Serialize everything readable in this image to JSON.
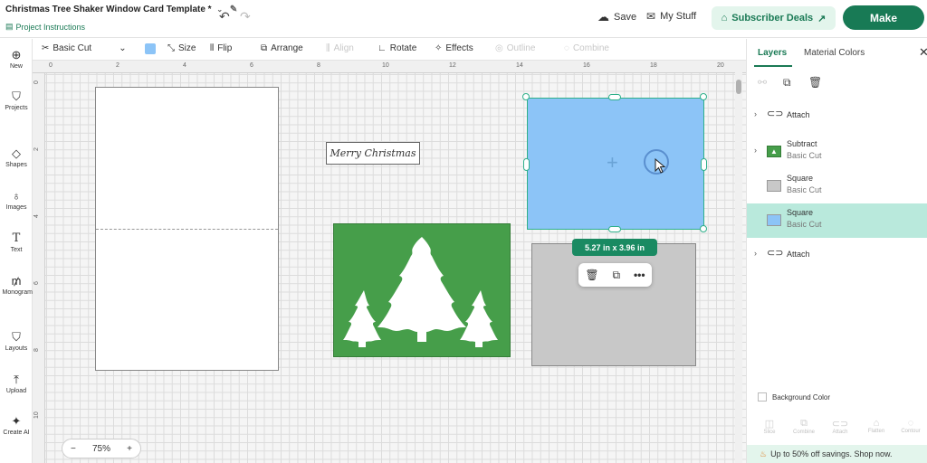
{
  "header": {
    "title": "Christmas Tree Shaker Window Card Template *",
    "project_instructions": "Project Instructions",
    "save": "Save",
    "my_stuff": "My Stuff",
    "subscriber_deals": "Subscriber Deals",
    "make": "Make"
  },
  "toolbar": {
    "operation": "Basic Cut",
    "size": "Size",
    "flip": "Flip",
    "arrange": "Arrange",
    "align": "Align",
    "rotate": "Rotate",
    "effects": "Effects",
    "outline": "Outline",
    "combine": "Combine",
    "swatch_color": "#8cc4f7"
  },
  "sidebar": {
    "items": [
      {
        "label": "New",
        "icon": "plus-circle-icon"
      },
      {
        "label": "Projects",
        "icon": "shirt-icon"
      },
      {
        "label": "Shapes",
        "icon": "shapes-icon"
      },
      {
        "label": "Images",
        "icon": "lightbulb-icon"
      },
      {
        "label": "Text",
        "icon": "text-icon"
      },
      {
        "label": "Monogram",
        "icon": "monogram-icon"
      },
      {
        "label": "Layouts",
        "icon": "layouts-icon"
      },
      {
        "label": "Upload",
        "icon": "upload-icon"
      },
      {
        "label": "Create AI",
        "icon": "sparkle-icon"
      }
    ]
  },
  "rulers": {
    "top": [
      "0",
      "2",
      "4",
      "6",
      "8",
      "10",
      "12",
      "14",
      "16",
      "18",
      "20"
    ],
    "left": [
      "0",
      "2",
      "4",
      "6",
      "8",
      "10"
    ]
  },
  "canvas": {
    "merry_text": "Merry Christmas",
    "dimensions": "5.27 in x 3.96 in",
    "zoom": "75%",
    "zoom_minus": "−",
    "zoom_plus": "+",
    "colors": {
      "green_panel": "#469e4a",
      "blue_square": "#8cc4f7",
      "grey_square": "#c8c8c8",
      "selection": "#2eb08a"
    }
  },
  "panel": {
    "tabs": [
      "Layers",
      "Material Colors"
    ],
    "layers": [
      {
        "name": "Attach",
        "sub": "",
        "expandable": true,
        "icon": "attach-icon"
      },
      {
        "name": "Subtract",
        "sub": "Basic Cut",
        "expandable": true,
        "icon": "tree-thumbnail"
      },
      {
        "name": "Square",
        "sub": "Basic Cut",
        "expandable": false,
        "icon": "grey-square-thumbnail"
      },
      {
        "name": "Square",
        "sub": "Basic Cut",
        "expandable": false,
        "icon": "blue-square-thumbnail",
        "selected": true
      },
      {
        "name": "Attach",
        "sub": "",
        "expandable": true,
        "icon": "attach-icon"
      }
    ],
    "background_color": "Background Color",
    "bottom_tools": [
      "Slice",
      "Combine",
      "Attach",
      "Flatten",
      "Contour"
    ],
    "promo": "Up to 50% off savings. Shop now."
  }
}
